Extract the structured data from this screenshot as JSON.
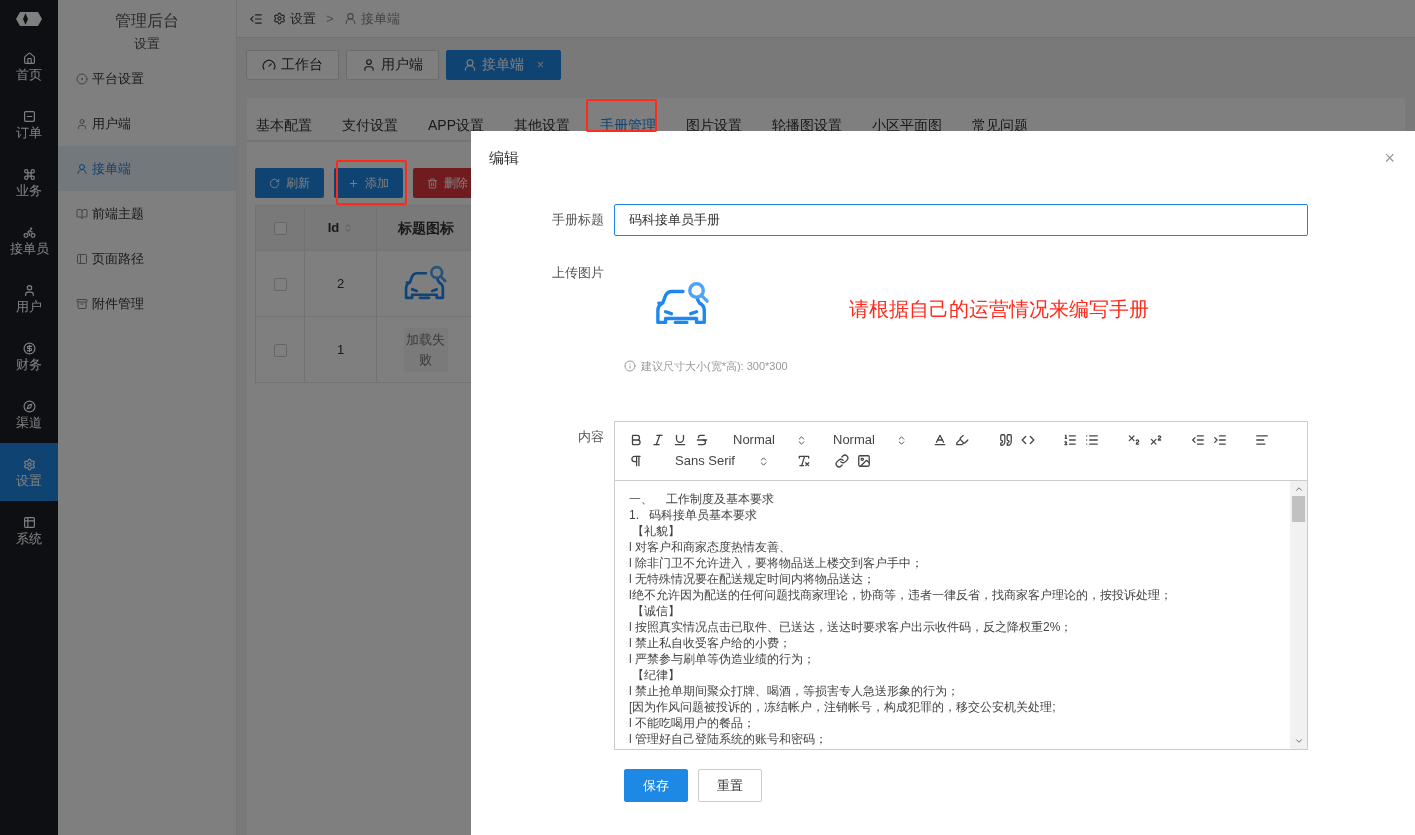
{
  "nav": [
    {
      "label": "首页",
      "selected": false
    },
    {
      "label": "订单",
      "selected": false
    },
    {
      "label": "业务",
      "selected": false
    },
    {
      "label": "接单员",
      "selected": false
    },
    {
      "label": "用户",
      "selected": false
    },
    {
      "label": "财务",
      "selected": false
    },
    {
      "label": "渠道",
      "selected": false
    },
    {
      "label": "设置",
      "selected": true
    },
    {
      "label": "系统",
      "selected": false
    }
  ],
  "sidebar": {
    "title": "管理后台",
    "subtitle": "设置",
    "items": [
      {
        "label": "平台设置",
        "selected": false
      },
      {
        "label": "用户端",
        "selected": false
      },
      {
        "label": "接单端",
        "selected": true
      },
      {
        "label": "前端主题",
        "selected": false
      },
      {
        "label": "页面路径",
        "selected": false
      },
      {
        "label": "附件管理",
        "selected": false
      }
    ]
  },
  "breadcrumb": [
    "设置",
    ">",
    "接单端"
  ],
  "page_tabs": [
    {
      "label": "工作台",
      "selected": false
    },
    {
      "label": "用户端",
      "selected": false
    },
    {
      "label": "接单端",
      "selected": true,
      "close": "×"
    }
  ],
  "settings_tabs": [
    {
      "label": "基本配置",
      "selected": false
    },
    {
      "label": "支付设置",
      "selected": false
    },
    {
      "label": "APP设置",
      "selected": false
    },
    {
      "label": "其他设置",
      "selected": false
    },
    {
      "label": "手册管理",
      "selected": true
    },
    {
      "label": "图片设置",
      "selected": false
    },
    {
      "label": "轮播图设置",
      "selected": false
    },
    {
      "label": "小区平面图",
      "selected": false
    },
    {
      "label": "常见问题",
      "selected": false
    }
  ],
  "actions": [
    {
      "kind": "refresh",
      "label": "刷新"
    },
    {
      "kind": "add",
      "label": "添加"
    },
    {
      "kind": "delete",
      "label": "删除"
    }
  ],
  "table": {
    "all_checked": false,
    "columns": [
      "Id",
      "标题图标"
    ],
    "rows": [
      {
        "id": "2",
        "checked": false
      },
      {
        "id": "1",
        "checked": false,
        "image": {
          "kind": "failed",
          "text": "加载失败"
        }
      }
    ]
  },
  "dialog": {
    "title": "编辑",
    "close": "×",
    "title_label": "手册标题",
    "title_value": "码科接单员手册",
    "upload_label": "上传图片",
    "note": "请根据自己的运营情况来编写手册",
    "hint": "建议尺寸大小(宽*高): 300*300",
    "content_label": "内容",
    "pickers": [
      "Normal",
      "Normal",
      "Sans Serif"
    ],
    "content_lines": [
      "一、    工作制度及基本要求",
      "1.   码科接单员基本要求",
      " 【礼貌】",
      "l 对客户和商家态度热情友善、",
      "l 除非门卫不允许进入，要将物品送上楼交到客户手中；",
      "l 无特殊情况要在配送规定时间内将物品送达；",
      "l绝不允许因为配送的任何问题找商家理论，协商等，违者一律反省，找商家客户理论的，按投诉处理；",
      " 【诚信】",
      "l 按照真实情况点击已取件、已送达，送达时要求客户出示收件码，反之降权重2%；",
      "l 禁止私自收受客户给的小费；",
      "l 严禁参与刷单等伪造业绩的行为；",
      " 【纪律】",
      "l 禁止抢单期间聚众打牌、喝酒，等损害专人急送形象的行为；",
      "[因为作风问题被投诉的，冻结帐户，注销帐号，构成犯罪的，移交公安机关处理;",
      "l 不能吃喝用户的餐品；",
      "l 管理好自己登陆系统的账号和密码；"
    ],
    "buttons": [
      {
        "kind": "primary",
        "label": "保存"
      },
      {
        "kind": "default",
        "label": "重置"
      }
    ]
  }
}
